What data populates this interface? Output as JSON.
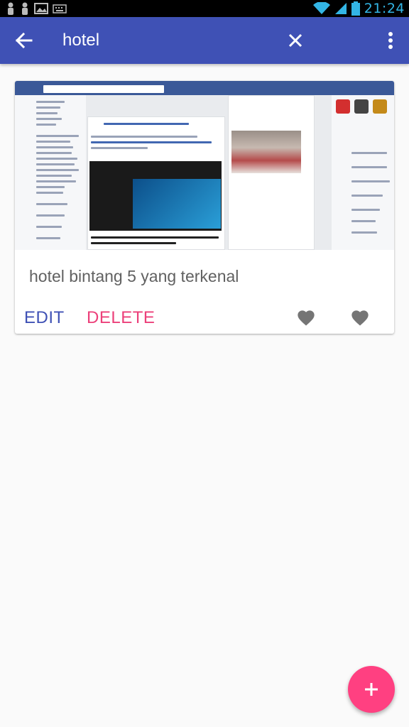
{
  "status_bar": {
    "time": "21:24",
    "icons": [
      "notification-icon",
      "notification-icon",
      "image-icon",
      "keyboard-icon",
      "wifi-icon",
      "signal-icon",
      "battery-icon"
    ]
  },
  "app_bar": {
    "back_icon": "arrow-back-icon",
    "search_query": "hotel",
    "clear_icon": "close-icon",
    "more_icon": "more-vert-icon",
    "color": "#3f51b5"
  },
  "result_card": {
    "thumbnail": "screenshot-image",
    "title": "hotel bintang 5 yang terkenal",
    "edit_label": "EDIT",
    "delete_label": "DELETE",
    "favorite_icons": [
      "heart-icon",
      "heart-icon"
    ]
  },
  "fab": {
    "icon": "add-icon",
    "color": "#ff4081"
  },
  "colors": {
    "primary": "#3f51b5",
    "accent": "#ec407a",
    "title_text": "#616161",
    "status_accent": "#33b5e5"
  }
}
